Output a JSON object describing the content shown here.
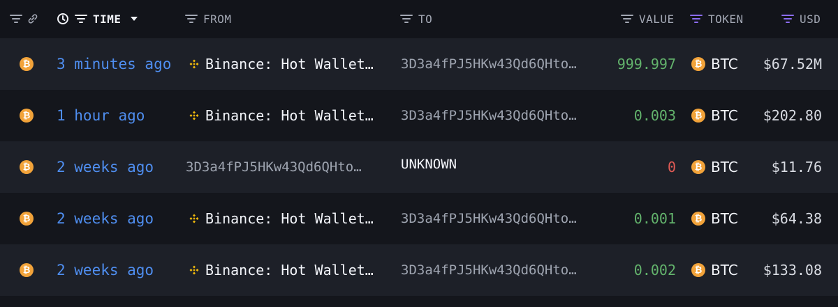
{
  "colors": {
    "background": "#14161c",
    "row_alt": "#1d2028",
    "time_link": "#4f8ef0",
    "value_positive": "#63b36c",
    "value_zero": "#e25b55",
    "btc_orange": "#f2a33a",
    "binance_yellow": "#f0b90b",
    "token_filter_purple": "#8b6cf0"
  },
  "header": {
    "time_label": "TIME",
    "from_label": "FROM",
    "to_label": "TO",
    "value_label": "VALUE",
    "token_label": "TOKEN",
    "usd_label": "USD"
  },
  "rows": [
    {
      "time": "3 minutes ago",
      "from": "Binance: Hot Wallet…",
      "from_is_entity": true,
      "to": "3D3a4fPJ5HKw43Qd6QHto…",
      "to_is_unknown": false,
      "value": "999.997",
      "value_color": "green",
      "token": "BTC",
      "usd": "$67.52M"
    },
    {
      "time": "1 hour ago",
      "from": "Binance: Hot Wallet…",
      "from_is_entity": true,
      "to": "3D3a4fPJ5HKw43Qd6QHto…",
      "to_is_unknown": false,
      "value": "0.003",
      "value_color": "green",
      "token": "BTC",
      "usd": "$202.80"
    },
    {
      "time": "2 weeks ago",
      "from": "3D3a4fPJ5HKw43Qd6QHto…",
      "from_is_entity": false,
      "to": "UNKNOWN",
      "to_is_unknown": true,
      "value": "0",
      "value_color": "red",
      "token": "BTC",
      "usd": "$11.76"
    },
    {
      "time": "2 weeks ago",
      "from": "Binance: Hot Wallet…",
      "from_is_entity": true,
      "to": "3D3a4fPJ5HKw43Qd6QHto…",
      "to_is_unknown": false,
      "value": "0.001",
      "value_color": "green",
      "token": "BTC",
      "usd": "$64.38"
    },
    {
      "time": "2 weeks ago",
      "from": "Binance: Hot Wallet…",
      "from_is_entity": true,
      "to": "3D3a4fPJ5HKw43Qd6QHto…",
      "to_is_unknown": false,
      "value": "0.002",
      "value_color": "green",
      "token": "BTC",
      "usd": "$133.08"
    }
  ]
}
